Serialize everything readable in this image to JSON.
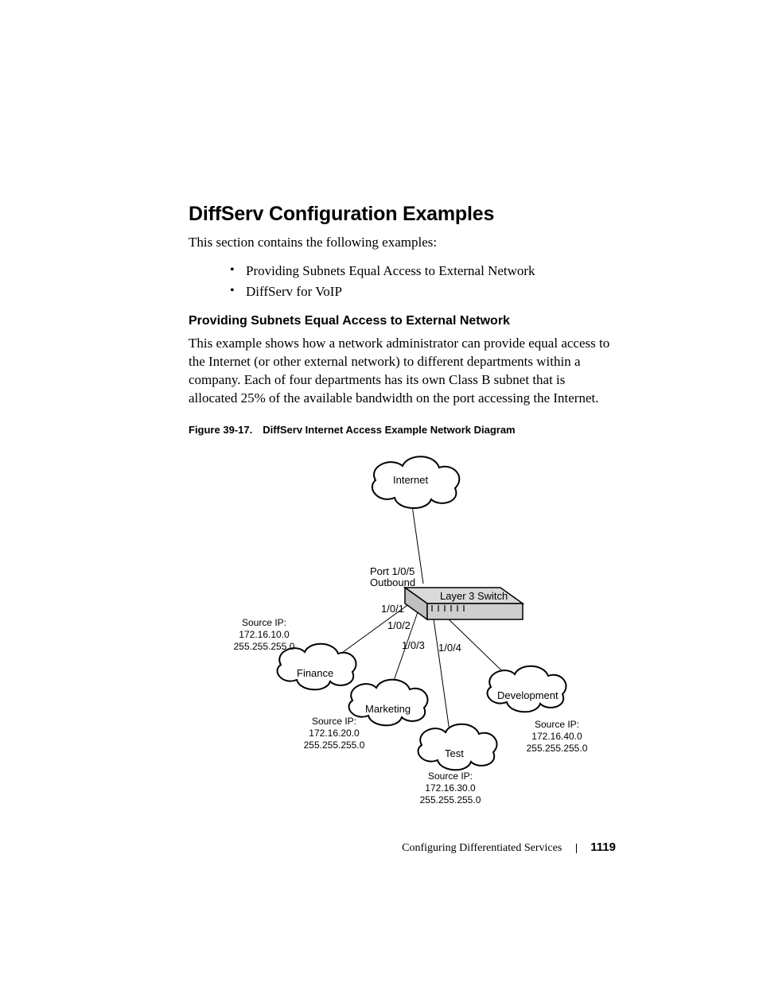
{
  "title": "DiffServ Configuration Examples",
  "intro": "This section contains the following examples:",
  "bullets": [
    "Providing Subnets Equal Access to External Network",
    "DiffServ for VoIP"
  ],
  "subhead": "Providing Subnets Equal Access to External Network",
  "para": "This example shows how a network administrator can provide equal access to the Internet (or other external network) to different departments within a company. Each of four departments has its own Class B subnet that is allocated 25% of the available bandwidth on the port accessing the Internet.",
  "figure_caption": "Figure 39-17. DiffServ Internet Access Example Network Diagram",
  "diagram": {
    "internet": "Internet",
    "switch": "Layer 3 Switch",
    "port_out_l1": "Port 1/0/5",
    "port_out_l2": "Outbound",
    "ports": {
      "p1": "1/0/1",
      "p2": "1/0/2",
      "p3": "1/0/3",
      "p4": "1/0/4"
    },
    "clouds": {
      "finance": "Finance",
      "marketing": "Marketing",
      "test": "Test",
      "development": "Development"
    },
    "ip": {
      "finance": {
        "l1": "Source IP:",
        "l2": "172.16.10.0",
        "l3": "255.255.255.0"
      },
      "marketing": {
        "l1": "Source IP:",
        "l2": "172.16.20.0",
        "l3": "255.255.255.0"
      },
      "test": {
        "l1": "Source IP:",
        "l2": "172.16.30.0",
        "l3": "255.255.255.0"
      },
      "development": {
        "l1": "Source IP:",
        "l2": "172.16.40.0",
        "l3": "255.255.255.0"
      }
    }
  },
  "footer": {
    "section": "Configuring Differentiated Services",
    "page": "1119"
  }
}
